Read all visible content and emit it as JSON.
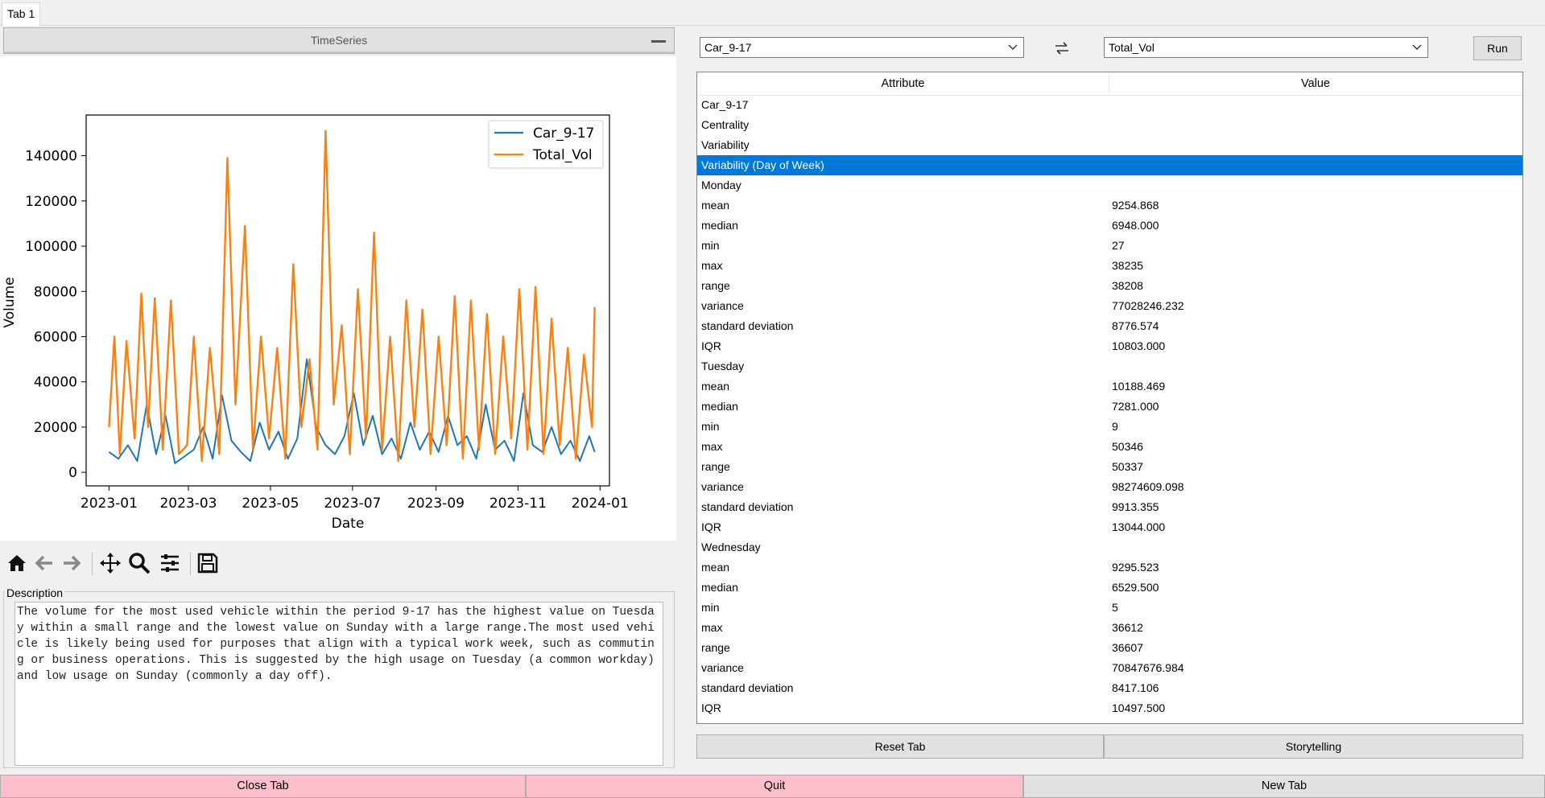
{
  "tabs": [
    "Tab 1"
  ],
  "left_panel": {
    "header_button": "TimeSeries",
    "description_label": "Description",
    "description_text": "The volume for the most used vehicle within the period 9-17 has the highest value on Tuesday within a small range and the lowest value on Sunday with a large range.The most used vehicle is likely being used for purposes that align with a typical work week, such as commuting or business operations. This is suggested by the high usage on Tuesday (a common workday) and low usage on Sunday (commonly a day off)."
  },
  "toolbar_icons": [
    "home-icon",
    "back-arrow-icon",
    "forward-arrow-icon",
    "pan-icon",
    "zoom-icon",
    "configure-subplots-icon",
    "save-icon"
  ],
  "right_panel": {
    "combo_left": "Car_9-17",
    "combo_right": "Total_Vol",
    "run_label": "Run",
    "columns": [
      "Attribute",
      "Value"
    ],
    "rows": [
      {
        "attr": "Car_9-17",
        "value": ""
      },
      {
        "attr": "Centrality",
        "value": ""
      },
      {
        "attr": "Variability",
        "value": ""
      },
      {
        "attr": "Variability (Day of Week)",
        "value": "",
        "selected": true
      },
      {
        "attr": "Monday",
        "value": ""
      },
      {
        "attr": "mean",
        "value": "9254.868"
      },
      {
        "attr": "median",
        "value": "6948.000"
      },
      {
        "attr": "min",
        "value": "27"
      },
      {
        "attr": "max",
        "value": "38235"
      },
      {
        "attr": "range",
        "value": "38208"
      },
      {
        "attr": "variance",
        "value": "77028246.232"
      },
      {
        "attr": "standard deviation",
        "value": "8776.574"
      },
      {
        "attr": "IQR",
        "value": "10803.000"
      },
      {
        "attr": "Tuesday",
        "value": ""
      },
      {
        "attr": "mean",
        "value": "10188.469"
      },
      {
        "attr": "median",
        "value": "7281.000"
      },
      {
        "attr": "min",
        "value": "9"
      },
      {
        "attr": "max",
        "value": "50346"
      },
      {
        "attr": "range",
        "value": "50337"
      },
      {
        "attr": "variance",
        "value": "98274609.098"
      },
      {
        "attr": "standard deviation",
        "value": "9913.355"
      },
      {
        "attr": "IQR",
        "value": "13044.000"
      },
      {
        "attr": "Wednesday",
        "value": ""
      },
      {
        "attr": "mean",
        "value": "9295.523"
      },
      {
        "attr": "median",
        "value": "6529.500"
      },
      {
        "attr": "min",
        "value": "5"
      },
      {
        "attr": "max",
        "value": "36612"
      },
      {
        "attr": "range",
        "value": "36607"
      },
      {
        "attr": "variance",
        "value": "70847676.984"
      },
      {
        "attr": "standard deviation",
        "value": "8417.106"
      },
      {
        "attr": "IQR",
        "value": "10497.500"
      }
    ],
    "reset_label": "Reset Tab",
    "storytelling_label": "Storytelling"
  },
  "bottom_buttons": {
    "close": "Close Tab",
    "quit": "Quit",
    "new": "New Tab"
  },
  "colors": {
    "selection": "#0078d7",
    "series_car": "#1f77b4",
    "series_total": "#ff7f0e",
    "danger_button": "#ffc0cb"
  },
  "chart_data": {
    "type": "line",
    "xlabel": "Date",
    "ylabel": "Volume",
    "x_ticks": [
      "2023-01",
      "2023-03",
      "2023-05",
      "2023-07",
      "2023-09",
      "2023-11",
      "2024-01"
    ],
    "y_ticks": [
      0,
      20000,
      40000,
      60000,
      80000,
      100000,
      120000,
      140000
    ],
    "xlim": [
      "2022-12-15",
      "2024-01-08"
    ],
    "ylim": [
      -6000,
      158000
    ],
    "legend": "top-right",
    "series": [
      {
        "name": "Car_9-17",
        "x": [
          "2023-01-01",
          "2023-01-08",
          "2023-01-15",
          "2023-01-22",
          "2023-01-29",
          "2023-02-05",
          "2023-02-12",
          "2023-02-19",
          "2023-02-26",
          "2023-03-05",
          "2023-03-12",
          "2023-03-19",
          "2023-03-26",
          "2023-04-02",
          "2023-04-09",
          "2023-04-16",
          "2023-04-23",
          "2023-04-30",
          "2023-05-07",
          "2023-05-14",
          "2023-05-21",
          "2023-05-28",
          "2023-06-04",
          "2023-06-11",
          "2023-06-18",
          "2023-06-25",
          "2023-07-02",
          "2023-07-09",
          "2023-07-16",
          "2023-07-23",
          "2023-07-30",
          "2023-08-06",
          "2023-08-13",
          "2023-08-20",
          "2023-08-27",
          "2023-09-03",
          "2023-09-10",
          "2023-09-17",
          "2023-09-24",
          "2023-10-01",
          "2023-10-08",
          "2023-10-15",
          "2023-10-22",
          "2023-10-29",
          "2023-11-05",
          "2023-11-12",
          "2023-11-19",
          "2023-11-26",
          "2023-12-03",
          "2023-12-10",
          "2023-12-17",
          "2023-12-24",
          "2023-12-28"
        ],
        "y": [
          9000,
          6000,
          12000,
          5000,
          30000,
          8000,
          25000,
          4000,
          7000,
          10000,
          20000,
          6000,
          34000,
          14000,
          9000,
          5000,
          22000,
          10000,
          18000,
          6000,
          15000,
          50000,
          20000,
          12000,
          8000,
          16000,
          35000,
          12000,
          25000,
          8000,
          15000,
          6000,
          22000,
          10000,
          18000,
          9000,
          25000,
          12000,
          16000,
          6000,
          30000,
          10000,
          14000,
          5000,
          35000,
          12000,
          9000,
          20000,
          8000,
          14000,
          5000,
          16000,
          9000
        ]
      },
      {
        "name": "Total_Vol",
        "x": [
          "2023-01-01",
          "2023-01-05",
          "2023-01-09",
          "2023-01-14",
          "2023-01-20",
          "2023-01-25",
          "2023-01-30",
          "2023-02-04",
          "2023-02-10",
          "2023-02-16",
          "2023-02-22",
          "2023-02-28",
          "2023-03-05",
          "2023-03-11",
          "2023-03-17",
          "2023-03-24",
          "2023-03-30",
          "2023-04-05",
          "2023-04-12",
          "2023-04-18",
          "2023-04-24",
          "2023-04-30",
          "2023-05-06",
          "2023-05-12",
          "2023-05-18",
          "2023-05-24",
          "2023-05-30",
          "2023-06-05",
          "2023-06-11",
          "2023-06-17",
          "2023-06-23",
          "2023-06-29",
          "2023-07-05",
          "2023-07-11",
          "2023-07-17",
          "2023-07-23",
          "2023-07-29",
          "2023-08-04",
          "2023-08-10",
          "2023-08-16",
          "2023-08-22",
          "2023-08-28",
          "2023-09-03",
          "2023-09-09",
          "2023-09-15",
          "2023-09-21",
          "2023-09-27",
          "2023-10-03",
          "2023-10-09",
          "2023-10-15",
          "2023-10-21",
          "2023-10-27",
          "2023-11-02",
          "2023-11-08",
          "2023-11-14",
          "2023-11-20",
          "2023-11-26",
          "2023-12-02",
          "2023-12-08",
          "2023-12-14",
          "2023-12-20",
          "2023-12-26",
          "2023-12-28"
        ],
        "y": [
          20000,
          60000,
          8000,
          58000,
          15000,
          79000,
          20000,
          77000,
          10000,
          76000,
          8000,
          12000,
          60000,
          5000,
          55000,
          8000,
          139000,
          30000,
          109000,
          10000,
          60000,
          15000,
          55000,
          6000,
          92000,
          20000,
          50000,
          10000,
          151000,
          30000,
          65000,
          8000,
          81000,
          15000,
          106000,
          10000,
          60000,
          5000,
          76000,
          20000,
          72000,
          8000,
          60000,
          12000,
          78000,
          6000,
          76000,
          10000,
          70000,
          8000,
          60000,
          15000,
          81000,
          10000,
          82000,
          8000,
          68000,
          12000,
          55000,
          6000,
          52000,
          20000,
          73000
        ]
      }
    ]
  }
}
